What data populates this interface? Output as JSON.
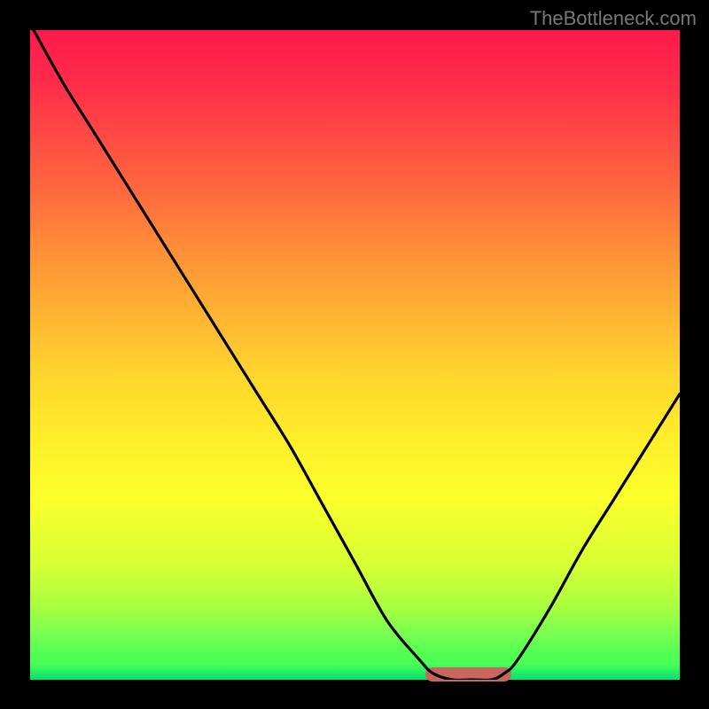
{
  "watermark": "TheBottleneck.com",
  "colors": {
    "background": "#000000",
    "curve": "#000000",
    "marker": "#c9665e"
  },
  "chart_data": {
    "type": "line",
    "title": "",
    "xlabel": "",
    "ylabel": "",
    "xlim": [
      0,
      100
    ],
    "ylim": [
      0,
      100
    ],
    "x": [
      0,
      5,
      10,
      15,
      20,
      25,
      30,
      35,
      40,
      45,
      50,
      55,
      60,
      62,
      65,
      68,
      71,
      73,
      75,
      80,
      85,
      90,
      95,
      100
    ],
    "values": [
      101,
      92,
      84,
      76,
      68,
      60,
      52,
      44,
      36,
      27,
      18,
      9,
      3,
      1,
      0,
      0,
      0,
      1,
      3,
      11,
      20,
      28,
      36,
      44
    ],
    "minimum_band": {
      "start_x": 62,
      "end_x": 73,
      "y": 0.8
    },
    "gradient_stops": [
      {
        "pos": 0,
        "color": "#ff1a4d"
      },
      {
        "pos": 50,
        "color": "#ffd52e"
      },
      {
        "pos": 100,
        "color": "#1fff47"
      }
    ],
    "annotations": [
      "TheBottleneck.com"
    ]
  }
}
